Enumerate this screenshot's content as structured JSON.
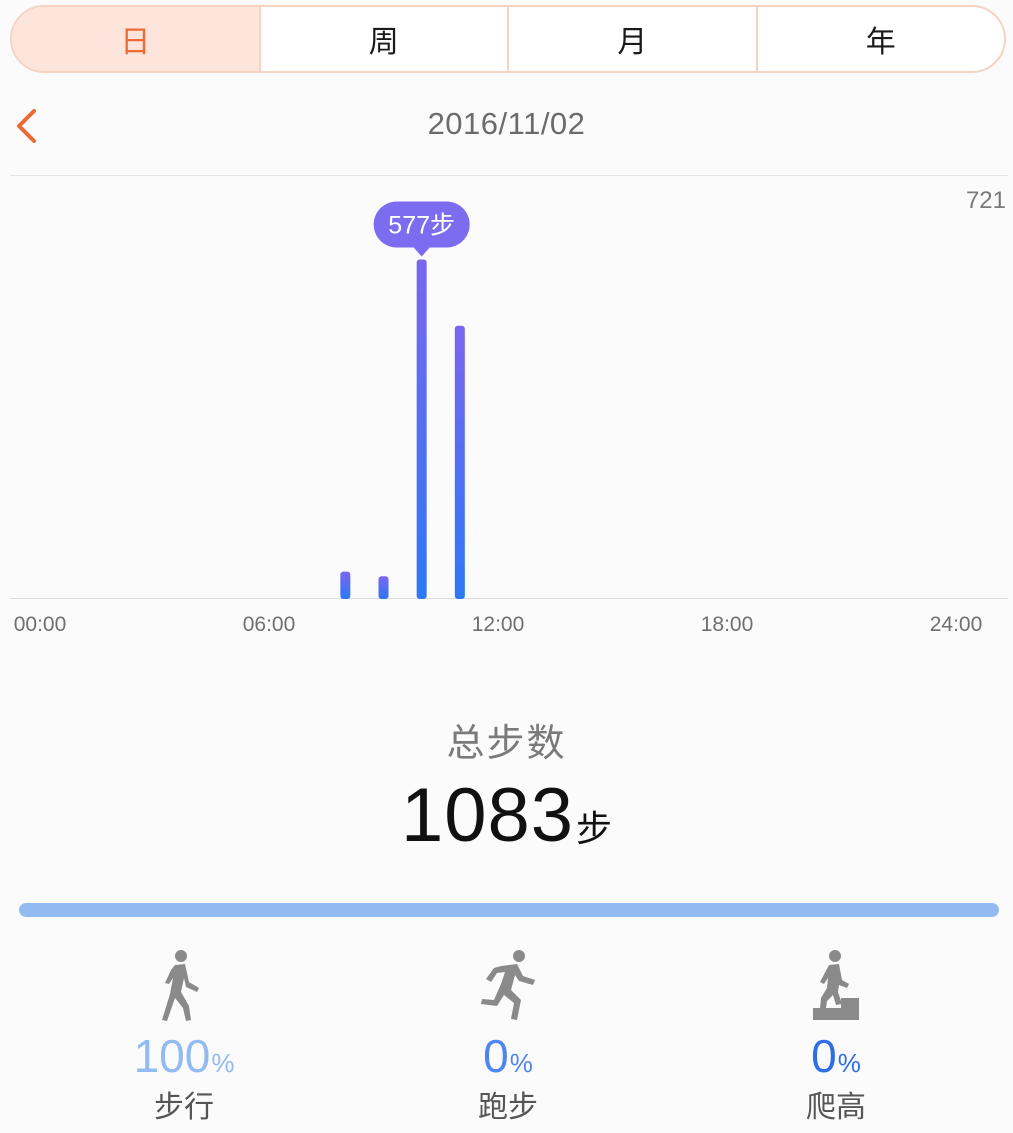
{
  "tabs": [
    {
      "label": "日",
      "active": true
    },
    {
      "label": "周",
      "active": false
    },
    {
      "label": "月",
      "active": false
    },
    {
      "label": "年",
      "active": false
    }
  ],
  "nav": {
    "date": "2016/11/02",
    "back_icon": "chevron-left-icon"
  },
  "chart_data": {
    "type": "bar",
    "title": "",
    "xlabel": "",
    "ylabel": "",
    "y_max_label": "721",
    "ylim": [
      0,
      721
    ],
    "xlim": [
      0,
      24
    ],
    "x_ticks": [
      "00:00",
      "06:00",
      "12:00",
      "18:00",
      "24:00"
    ],
    "bars": [
      {
        "hour": 8,
        "value": 45
      },
      {
        "hour": 9,
        "value": 37
      },
      {
        "hour": 10,
        "value": 577
      },
      {
        "hour": 11,
        "value": 464
      }
    ],
    "tooltip": {
      "hour": 10,
      "text": "577步"
    },
    "bar_color_top": "#7a66ee",
    "bar_color_bottom": "#2d78f7",
    "tooltip_color": "#7b6cf0",
    "grid": false
  },
  "summary": {
    "label": "总步数",
    "value": "1083",
    "unit": "步"
  },
  "distribution": {
    "walk_fraction": 1.0,
    "fill_color": "#92bbf1"
  },
  "activities": [
    {
      "icon": "walking-icon",
      "value": "100",
      "unit": "%",
      "label": "步行",
      "color": "#92bbf1"
    },
    {
      "icon": "running-icon",
      "value": "0",
      "unit": "%",
      "label": "跑步",
      "color": "#4d86ee"
    },
    {
      "icon": "stair-climbing-icon",
      "value": "0",
      "unit": "%",
      "label": "爬高",
      "color": "#2e6fe8"
    }
  ]
}
